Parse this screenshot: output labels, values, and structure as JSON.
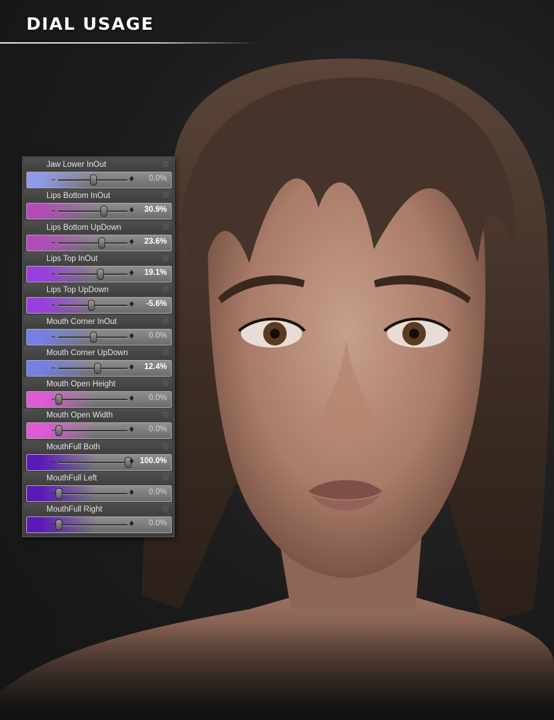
{
  "header": {
    "title": "DIAL USAGE"
  },
  "dials": [
    {
      "label": "Jaw Lower InOut",
      "value_text": "0.0%",
      "value": 0.0,
      "color": "#8f9be8",
      "accent": false
    },
    {
      "label": "Lips Bottom InOut",
      "value_text": "30.9%",
      "value": 30.9,
      "color": "#b24bb8",
      "accent": true
    },
    {
      "label": "Lips Bottom UpDown",
      "value_text": "23.6%",
      "value": 23.6,
      "color": "#b24bb8",
      "accent": true
    },
    {
      "label": "Lips Top InOut",
      "value_text": "19.1%",
      "value": 19.1,
      "color": "#9a3ddf",
      "accent": true
    },
    {
      "label": "Lips Top UpDown",
      "value_text": "-5.6%",
      "value": -5.6,
      "color": "#9a3ddf",
      "accent": true
    },
    {
      "label": "Mouth Corner InOut",
      "value_text": "0.0%",
      "value": 0.0,
      "color": "#7580e4",
      "accent": false
    },
    {
      "label": "Mouth Corner UpDown",
      "value_text": "12.4%",
      "value": 12.4,
      "color": "#7580e4",
      "accent": true
    },
    {
      "label": "Mouth Open Height",
      "value_text": "0.0%",
      "value": 0.0,
      "color": "#e05ad8",
      "accent": false
    },
    {
      "label": "Mouth Open Width",
      "value_text": "0.0%",
      "value": 0.0,
      "color": "#e05ad8",
      "accent": false
    },
    {
      "label": "MouthFull Both",
      "value_text": "100.0%",
      "value": 100.0,
      "color": "#5a18b8",
      "accent": true
    },
    {
      "label": "MouthFull Left",
      "value_text": "0.0%",
      "value": 0.0,
      "color": "#5a18b8",
      "accent": false
    },
    {
      "label": "MouthFull Right",
      "value_text": "0.0%",
      "value": 0.0,
      "color": "#5a18b8",
      "accent": false
    }
  ],
  "icons": {
    "settings": "gear-icon",
    "decrease": "minus-icon",
    "increase": "plus-icon"
  }
}
